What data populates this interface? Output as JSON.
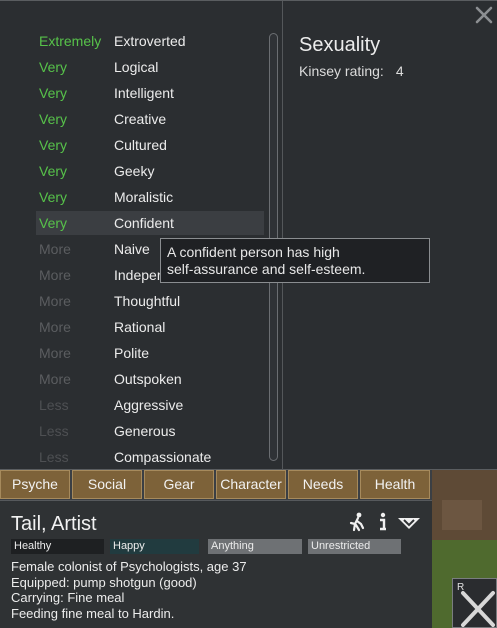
{
  "window": {
    "close_icon": "close-x-icon"
  },
  "traits": [
    {
      "level": "Extremely",
      "name": "Extroverted",
      "level_color": "#57c24a"
    },
    {
      "level": "Very",
      "name": "Logical",
      "level_color": "#57c24a"
    },
    {
      "level": "Very",
      "name": "Intelligent",
      "level_color": "#57c24a"
    },
    {
      "level": "Very",
      "name": "Creative",
      "level_color": "#57c24a"
    },
    {
      "level": "Very",
      "name": "Cultured",
      "level_color": "#57c24a"
    },
    {
      "level": "Very",
      "name": "Geeky",
      "level_color": "#57c24a"
    },
    {
      "level": "Very",
      "name": "Moralistic",
      "level_color": "#57c24a"
    },
    {
      "level": "Very",
      "name": "Confident",
      "level_color": "#57c24a",
      "highlighted": true
    },
    {
      "level": "More",
      "name": "Naive",
      "level_color": "#5b5d60"
    },
    {
      "level": "More",
      "name": "Indeper",
      "level_color": "#5b5d60"
    },
    {
      "level": "More",
      "name": "Thoughtful",
      "level_color": "#5b5d60"
    },
    {
      "level": "More",
      "name": "Rational",
      "level_color": "#5b5d60"
    },
    {
      "level": "More",
      "name": "Polite",
      "level_color": "#5b5d60"
    },
    {
      "level": "More",
      "name": "Outspoken",
      "level_color": "#5b5d60"
    },
    {
      "level": "Less",
      "name": "Aggressive",
      "level_color": "#4e5053"
    },
    {
      "level": "Less",
      "name": "Generous",
      "level_color": "#4e5053"
    },
    {
      "level": "Less",
      "name": "Compassionate",
      "level_color": "#4e5053"
    }
  ],
  "sexuality": {
    "title": "Sexuality",
    "kinsey_label": "Kinsey rating:",
    "kinsey_value": "4"
  },
  "tooltip": {
    "line1": "A confident person has high",
    "line2": "self-assurance and self-esteem."
  },
  "tabs": [
    "Psyche",
    "Social",
    "Gear",
    "Character",
    "Needs",
    "Health"
  ],
  "pawn": {
    "name": "Tail, Artist",
    "statuses": [
      {
        "label": "Healthy",
        "color": "#1e2022"
      },
      {
        "label": "Happy",
        "color": "#213b3f"
      },
      {
        "label": "Anything",
        "color": "#6e7174"
      },
      {
        "label": "Unrestricted",
        "color": "#6e7174"
      }
    ],
    "info": [
      "Female colonist of Psychologists, age 37",
      "Equipped: pump shotgun (good)",
      "Carrying: Fine meal",
      "Feeding fine meal to Hardin."
    ],
    "icons": [
      "draft-pawn-icon",
      "info-icon",
      "rename-dropdown-icon"
    ]
  },
  "mini_button": {
    "label": "R",
    "icon": "crossed-swords-icon"
  }
}
